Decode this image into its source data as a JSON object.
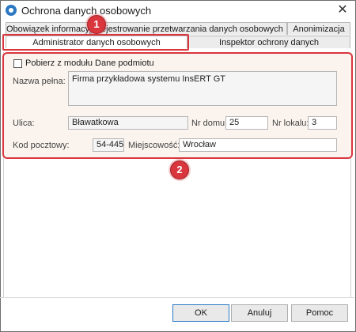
{
  "window": {
    "title": "Ochrona danych osobowych",
    "app_icon": "app-icon",
    "close_icon": "close-icon"
  },
  "tabs_row1": [
    {
      "label": "Obowiązek informacyjny"
    },
    {
      "label": "Rejestrowanie przetwarzania danych osobowych"
    },
    {
      "label": "Anonimizacja"
    }
  ],
  "tabs_row2": [
    {
      "label": "Administrator danych osobowych",
      "active": true
    },
    {
      "label": "Inspektor ochrony danych"
    }
  ],
  "annotations": {
    "badge1": "1",
    "badge2": "2",
    "highlight_color": "#d9363e"
  },
  "form": {
    "checkbox_label": "Pobierz z modułu Dane podmiotu",
    "checkbox_checked": false,
    "nazwa_label": "Nazwa pełna:",
    "nazwa_value": "Firma przykładowa systemu InsERT GT",
    "ulica_label": "Ulica:",
    "ulica_value": "Bławatkowa",
    "nr_domu_label": "Nr domu:",
    "nr_domu_value": "25",
    "nr_lokalu_label": "Nr lokalu:",
    "nr_lokalu_value": "3",
    "kod_label": "Kod pocztowy:",
    "kod_value": "54-445",
    "miejscowosc_label": "Miejscowość:",
    "miejscowosc_value": "Wrocław"
  },
  "buttons": {
    "ok": "OK",
    "cancel": "Anuluj",
    "help": "Pomoc"
  }
}
